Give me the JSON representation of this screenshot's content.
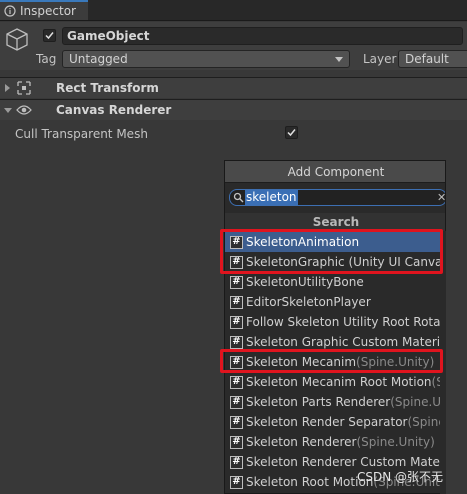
{
  "tab": {
    "label": "Inspector",
    "icon": "info-icon"
  },
  "object": {
    "icon": "cube-icon",
    "active": true,
    "name": "GameObject",
    "tag_label": "Tag",
    "tag_value": "Untagged",
    "layer_label": "Layer",
    "layer_value": "Default"
  },
  "components": [
    {
      "name": "Rect Transform",
      "icon": "rect-transform-icon",
      "expanded": false
    },
    {
      "name": "Canvas Renderer",
      "icon": "eye-icon",
      "expanded": true
    }
  ],
  "canvas_renderer": {
    "cull_label": "Cull Transparent Mesh",
    "cull_checked": true
  },
  "add_component": {
    "title": "Add Component",
    "search_value": "skeleton",
    "search_section": "Search",
    "items": [
      {
        "label": "SkeletonAnimation",
        "ns": "",
        "highlighted": true
      },
      {
        "label": "SkeletonGraphic (Unity UI Canvas)",
        "ns": ""
      },
      {
        "label": "SkeletonUtilityBone",
        "ns": ""
      },
      {
        "label": "EditorSkeletonPlayer",
        "ns": ""
      },
      {
        "label": "Follow Skeleton Utility Root Rotatic",
        "ns": ""
      },
      {
        "label": "Skeleton Graphic Custom Materials",
        "ns": ""
      },
      {
        "label": "Skeleton Mecanim",
        "ns": "(Spine.Unity)"
      },
      {
        "label": "Skeleton Mecanim Root Motion",
        "ns": "(Sp"
      },
      {
        "label": "Skeleton Parts Renderer",
        "ns": "(Spine.Uni"
      },
      {
        "label": "Skeleton Render Separator",
        "ns": "(Spine.U"
      },
      {
        "label": "Skeleton Renderer",
        "ns": "(Spine.Unity)"
      },
      {
        "label": "Skeleton Renderer Custom Materia",
        "ns": ""
      },
      {
        "label": "Skeleton Root Motion",
        "ns": "(Spine.Unity)"
      }
    ]
  },
  "watermark": "CSDN @张不无",
  "colors": {
    "accent": "#3a79bb",
    "highlight": "#e0141e"
  }
}
